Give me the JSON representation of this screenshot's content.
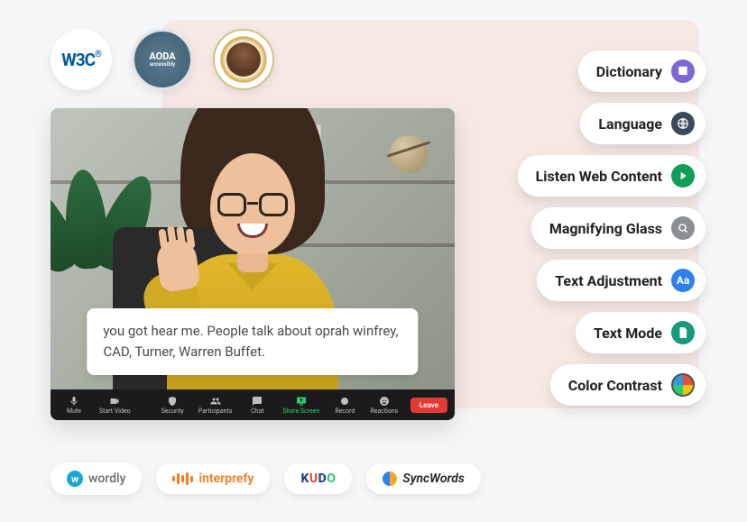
{
  "badges": {
    "w3c": "W3C",
    "aoda": "AODA"
  },
  "caption": "you got hear me. People talk about oprah winfrey, CAD, Turner, Warren Buffet.",
  "toolbar": {
    "mute": "Mute",
    "start_video": "Start Video",
    "security": "Security",
    "participants": "Participants",
    "chat": "Chat",
    "share_screen": "Share Screen",
    "record": "Record",
    "reactions": "Reactions",
    "leave": "Leave"
  },
  "pills": [
    {
      "label": "Dictionary",
      "icon": "book-icon",
      "color": "#7c66d9"
    },
    {
      "label": "Language",
      "icon": "globe-icon",
      "color": "#3b4a5a"
    },
    {
      "label": "Listen Web Content",
      "icon": "play-icon",
      "color": "#0f9d58"
    },
    {
      "label": "Magnifying Glass",
      "icon": "search-icon",
      "color": "#8a8f94"
    },
    {
      "label": "Text Adjustment",
      "icon": "aa-icon",
      "color": "#2f80ed"
    },
    {
      "label": "Text Mode",
      "icon": "doc-icon",
      "color": "#159a7f"
    },
    {
      "label": "Color Contrast",
      "icon": "contrast-icon",
      "color": "#d85b8c"
    }
  ],
  "partners": {
    "wordly": "wordly",
    "interprefy": "interprefy",
    "kudo": "KUDO",
    "syncwords": "SyncWords"
  }
}
